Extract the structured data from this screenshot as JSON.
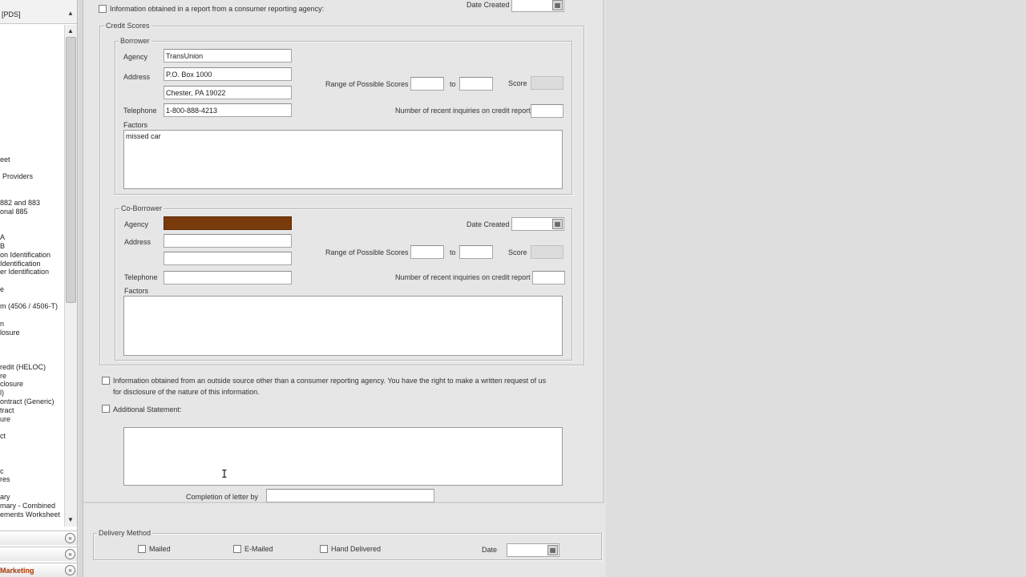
{
  "sidebar": {
    "header": "[PDS]",
    "items": [
      "eet",
      "Providers",
      "882 and 883",
      "onal 885",
      "A",
      "B",
      "on Identification",
      "Identification",
      "er Identification",
      "e",
      "m (4506 / 4506-T)",
      "n",
      "losure",
      "redit (HELOC)",
      "re",
      "closure",
      "l)",
      "ontract (Generic)",
      "tract",
      "ure",
      "ct",
      "c",
      "res",
      "ary",
      "mary - Combined",
      "ements Worksheet"
    ],
    "bottom_bar_label": "Marketing"
  },
  "form": {
    "top_checkbox_label": "Information obtained in a report from a consumer reporting agency:",
    "top_date_created_label": "Date Created",
    "credit_scores_title": "Credit Scores",
    "borrower": {
      "title": "Borrower",
      "agency_label": "Agency",
      "agency_value": "TransUnion",
      "address_label": "Address",
      "address_line1": "P.O. Box 1000",
      "address_line2": "Chester, PA 19022",
      "telephone_label": "Telephone",
      "telephone_value": "1-800-888-4213",
      "range_label": "Range of Possible Scores",
      "to_label": "to",
      "score_label": "Score",
      "inquiries_label": "Number of recent inquiries on credit report",
      "factors_label": "Factors",
      "factors_value": "missed car"
    },
    "coborrower": {
      "title": "Co-Borrower",
      "agency_label": "Agency",
      "address_label": "Address",
      "telephone_label": "Telephone",
      "date_created_label": "Date Created",
      "range_label": "Range of Possible Scores",
      "to_label": "to",
      "score_label": "Score",
      "inquiries_label": "Number of recent inquiries on credit report",
      "factors_label": "Factors",
      "agency_fill_color": "#7a3b0c"
    },
    "outside_source_line1": "Information obtained from an outside source other than a consumer reporting agency.  You have the right to make a written request of us",
    "outside_source_line2": "for disclosure of the nature of this information.",
    "additional_statement_label": "Additional Statement:",
    "completion_label": "Completion of letter by",
    "delivery": {
      "title": "Delivery Method",
      "mailed": "Mailed",
      "emailed": "E-Mailed",
      "hand_delivered": "Hand Delivered",
      "date_label": "Date"
    }
  }
}
